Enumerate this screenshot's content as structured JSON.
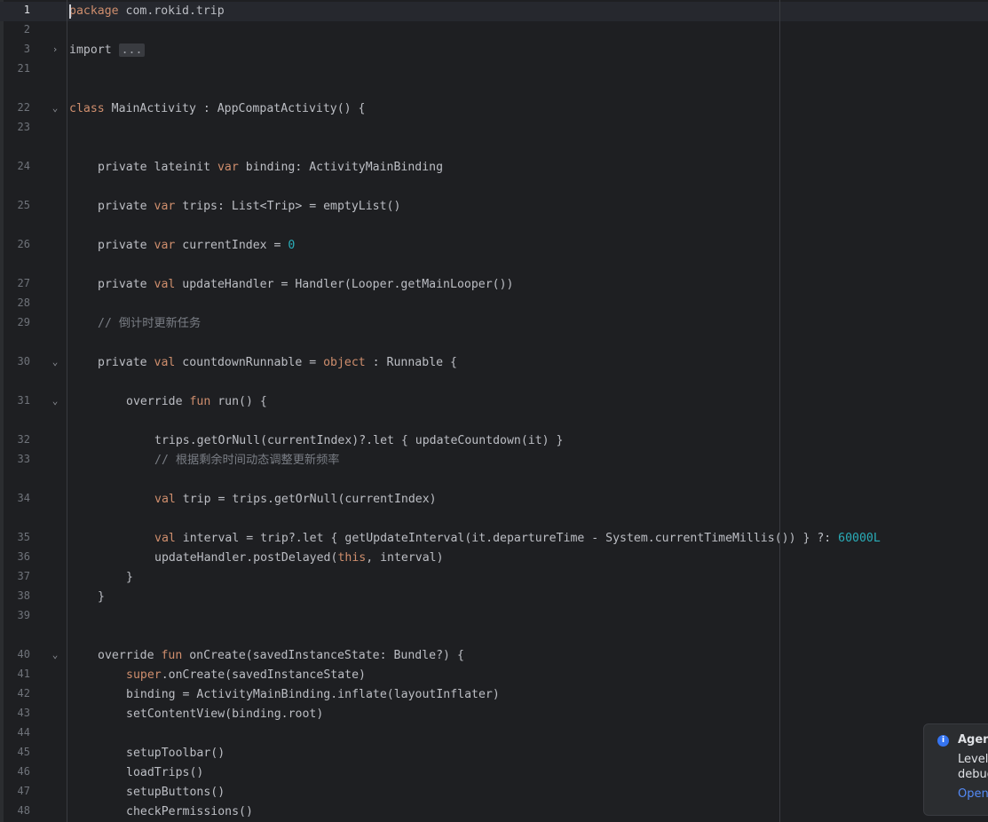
{
  "editor": {
    "lines": [
      {
        "n": "1",
        "indent": 0,
        "current": true,
        "fold": "",
        "segs": [
          [
            "kw",
            "package"
          ],
          [
            "",
            " com.rokid.trip"
          ]
        ]
      },
      {
        "n": "2",
        "indent": 0,
        "fold": "",
        "segs": []
      },
      {
        "n": "3",
        "indent": 0,
        "fold": "›",
        "segs": [
          [
            "",
            "import "
          ],
          [
            "fold-box",
            "..."
          ]
        ]
      },
      {
        "n": "21",
        "indent": 0,
        "fold": "",
        "segs": []
      },
      {
        "n": "22",
        "indent": 0,
        "fold": "⌄",
        "segs": [
          [
            "kw",
            "class"
          ],
          [
            "",
            " MainActivity : AppCompatActivity() {"
          ]
        ]
      },
      {
        "n": "23",
        "indent": 0,
        "fold": "",
        "segs": []
      },
      {
        "n": "24",
        "indent": 1,
        "fold": "",
        "segs": [
          [
            "",
            "private lateinit "
          ],
          [
            "kw",
            "var"
          ],
          [
            "",
            " binding: ActivityMainBinding"
          ]
        ]
      },
      {
        "n": "25",
        "indent": 1,
        "fold": "",
        "segs": [
          [
            "",
            "private "
          ],
          [
            "kw",
            "var"
          ],
          [
            "",
            " trips: List<Trip> = emptyList()"
          ]
        ]
      },
      {
        "n": "26",
        "indent": 1,
        "fold": "",
        "segs": [
          [
            "",
            "private "
          ],
          [
            "kw",
            "var"
          ],
          [
            "",
            " currentIndex = "
          ],
          [
            "num",
            "0"
          ]
        ]
      },
      {
        "n": "27",
        "indent": 1,
        "fold": "",
        "segs": [
          [
            "",
            "private "
          ],
          [
            "kw",
            "val"
          ],
          [
            "",
            " updateHandler = Handler(Looper.getMainLooper())"
          ]
        ]
      },
      {
        "n": "28",
        "indent": 0,
        "fold": "",
        "segs": []
      },
      {
        "n": "29",
        "indent": 1,
        "fold": "",
        "segs": [
          [
            "cm",
            "// 倒计时更新任务"
          ]
        ]
      },
      {
        "n": "30",
        "indent": 1,
        "fold": "⌄",
        "segs": [
          [
            "",
            "private "
          ],
          [
            "kw",
            "val"
          ],
          [
            "",
            " countdownRunnable = "
          ],
          [
            "kw",
            "object"
          ],
          [
            "",
            " : Runnable {"
          ]
        ]
      },
      {
        "n": "31",
        "indent": 2,
        "fold": "⌄",
        "segs": [
          [
            "",
            "override "
          ],
          [
            "kw",
            "fun"
          ],
          [
            "",
            " run() {"
          ]
        ]
      },
      {
        "n": "32",
        "indent": 3,
        "fold": "",
        "segs": [
          [
            "",
            "trips.getOrNull(currentIndex)?.let { updateCountdown(it) }"
          ]
        ]
      },
      {
        "n": "33",
        "indent": 3,
        "fold": "",
        "segs": [
          [
            "cm",
            "// 根据剩余时间动态调整更新频率"
          ]
        ]
      },
      {
        "n": "34",
        "indent": 3,
        "fold": "",
        "segs": [
          [
            "kw",
            "val"
          ],
          [
            "",
            " trip = trips.getOrNull(currentIndex)"
          ]
        ]
      },
      {
        "n": "35",
        "indent": 3,
        "fold": "",
        "segs": [
          [
            "kw",
            "val"
          ],
          [
            "",
            " interval = trip?.let { getUpdateInterval(it.departureTime - System.currentTimeMillis()) } ?: "
          ],
          [
            "num",
            "60000L"
          ]
        ]
      },
      {
        "n": "36",
        "indent": 3,
        "fold": "",
        "segs": [
          [
            "",
            "updateHandler.postDelayed("
          ],
          [
            "kw",
            "this"
          ],
          [
            "",
            ", interval)"
          ]
        ]
      },
      {
        "n": "37",
        "indent": 2,
        "fold": "",
        "segs": [
          [
            "",
            "}"
          ]
        ]
      },
      {
        "n": "38",
        "indent": 1,
        "fold": "",
        "segs": [
          [
            "",
            "}"
          ]
        ]
      },
      {
        "n": "39",
        "indent": 0,
        "fold": "",
        "segs": []
      },
      {
        "n": "40",
        "indent": 1,
        "fold": "⌄",
        "segs": [
          [
            "",
            "override "
          ],
          [
            "kw",
            "fun"
          ],
          [
            "",
            " onCreate(savedInstanceState: Bundle?) {"
          ]
        ]
      },
      {
        "n": "41",
        "indent": 2,
        "fold": "",
        "segs": [
          [
            "kw",
            "super"
          ],
          [
            "",
            ".onCreate(savedInstanceState)"
          ]
        ]
      },
      {
        "n": "42",
        "indent": 2,
        "fold": "",
        "segs": [
          [
            "",
            "binding = ActivityMainBinding.inflate(layoutInflater)"
          ]
        ]
      },
      {
        "n": "43",
        "indent": 2,
        "fold": "",
        "segs": [
          [
            "",
            "setContentView(binding.root)"
          ]
        ]
      },
      {
        "n": "44",
        "indent": 0,
        "fold": "",
        "segs": []
      },
      {
        "n": "45",
        "indent": 2,
        "fold": "",
        "segs": [
          [
            "",
            "setupToolbar()"
          ]
        ]
      },
      {
        "n": "46",
        "indent": 2,
        "fold": "",
        "segs": [
          [
            "",
            "loadTrips()"
          ]
        ]
      },
      {
        "n": "47",
        "indent": 2,
        "fold": "",
        "segs": [
          [
            "",
            "setupButtons()"
          ]
        ]
      },
      {
        "n": "48",
        "indent": 2,
        "fold": "",
        "segs": [
          [
            "",
            "checkPermissions()"
          ]
        ]
      }
    ]
  },
  "notification": {
    "icon": "info-icon",
    "title": "Agent",
    "body_line1": "Level (",
    "body_line2": "debug",
    "link": "Open"
  }
}
